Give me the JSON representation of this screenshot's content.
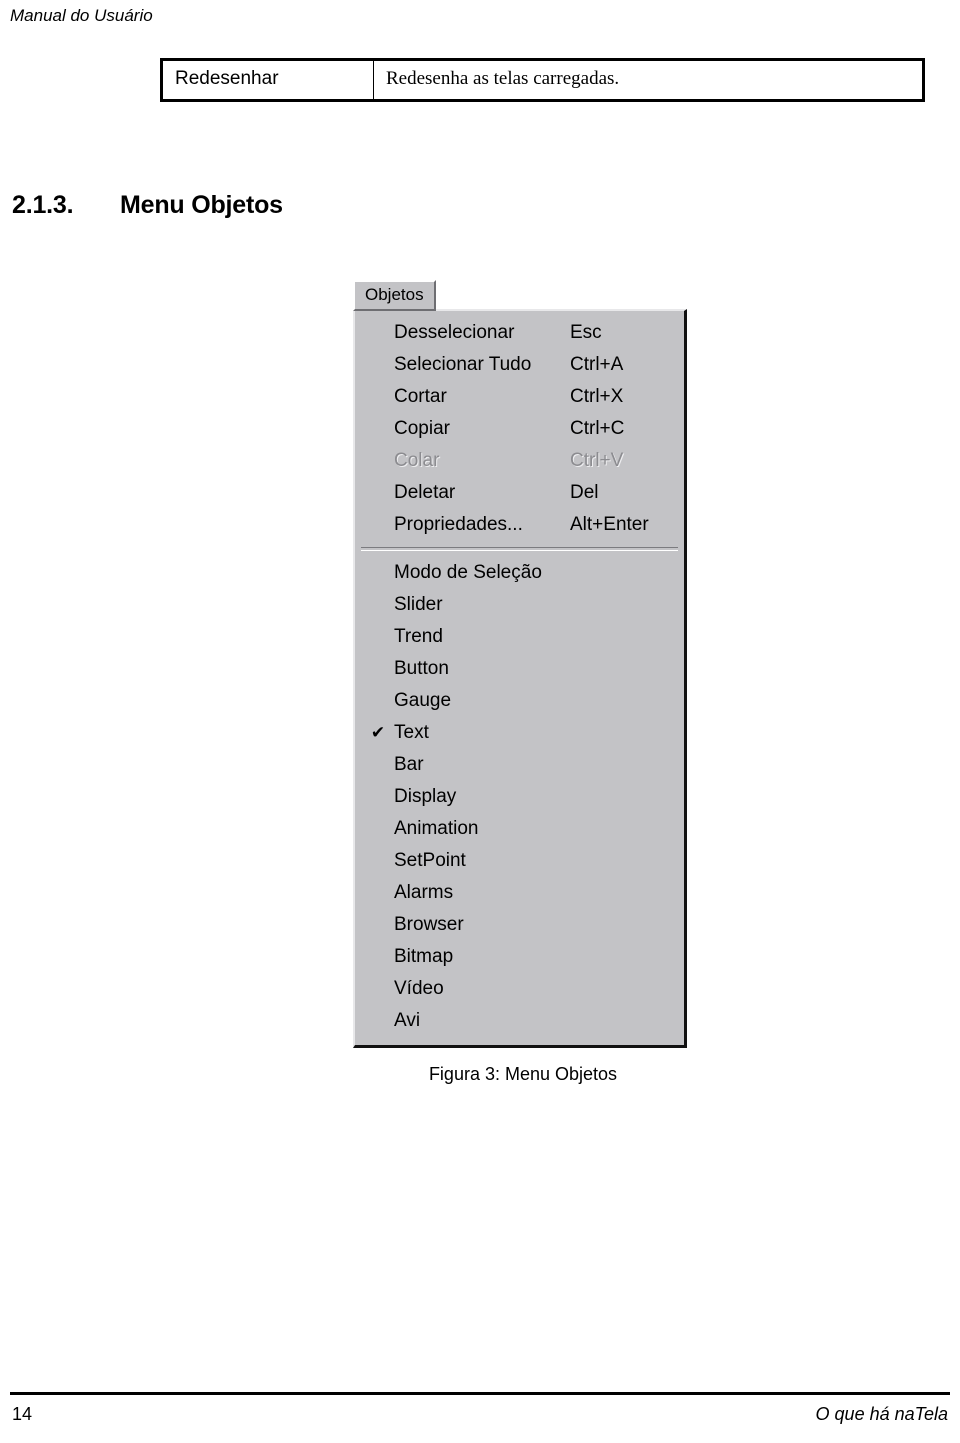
{
  "page": {
    "header_text": "Manual do Usuário",
    "footer_page_number": "14",
    "footer_doc_title": "O que há naTela",
    "background_color": "#ffffff"
  },
  "table": {
    "rows": [
      {
        "term": "Redesenhar",
        "description": "Redesenha as telas carregadas."
      }
    ]
  },
  "heading": {
    "number": "2.1.3.",
    "title": "Menu Objetos"
  },
  "figure": {
    "caption": "Figura 3: Menu Objetos",
    "menubar_button_label": "Objetos",
    "colors": {
      "menu_background": "#c3c3c6",
      "menu_highlight": "#e8e8ea",
      "menu_shadow": "#6e6e72",
      "menu_border": "#111111",
      "disabled_text": "#8c8c90",
      "text": "#000000"
    },
    "groups": [
      {
        "items": [
          {
            "label": "Desselecionar",
            "shortcut": "Esc",
            "checked": false,
            "disabled": false
          },
          {
            "label": "Selecionar Tudo",
            "shortcut": "Ctrl+A",
            "checked": false,
            "disabled": false
          },
          {
            "label": "Cortar",
            "shortcut": "Ctrl+X",
            "checked": false,
            "disabled": false
          },
          {
            "label": "Copiar",
            "shortcut": "Ctrl+C",
            "checked": false,
            "disabled": false
          },
          {
            "label": "Colar",
            "shortcut": "Ctrl+V",
            "checked": false,
            "disabled": true
          },
          {
            "label": "Deletar",
            "shortcut": "Del",
            "checked": false,
            "disabled": false
          },
          {
            "label": "Propriedades...",
            "shortcut": "Alt+Enter",
            "checked": false,
            "disabled": false
          }
        ]
      },
      {
        "items": [
          {
            "label": "Modo de Seleção",
            "shortcut": "",
            "checked": false,
            "disabled": false
          },
          {
            "label": "Slider",
            "shortcut": "",
            "checked": false,
            "disabled": false
          },
          {
            "label": "Trend",
            "shortcut": "",
            "checked": false,
            "disabled": false
          },
          {
            "label": "Button",
            "shortcut": "",
            "checked": false,
            "disabled": false
          },
          {
            "label": "Gauge",
            "shortcut": "",
            "checked": false,
            "disabled": false
          },
          {
            "label": "Text",
            "shortcut": "",
            "checked": true,
            "disabled": false
          },
          {
            "label": "Bar",
            "shortcut": "",
            "checked": false,
            "disabled": false
          },
          {
            "label": "Display",
            "shortcut": "",
            "checked": false,
            "disabled": false
          },
          {
            "label": "Animation",
            "shortcut": "",
            "checked": false,
            "disabled": false
          },
          {
            "label": "SetPoint",
            "shortcut": "",
            "checked": false,
            "disabled": false
          },
          {
            "label": "Alarms",
            "shortcut": "",
            "checked": false,
            "disabled": false
          },
          {
            "label": "Browser",
            "shortcut": "",
            "checked": false,
            "disabled": false
          },
          {
            "label": "Bitmap",
            "shortcut": "",
            "checked": false,
            "disabled": false
          },
          {
            "label": "Vídeo",
            "shortcut": "",
            "checked": false,
            "disabled": false
          },
          {
            "label": "Avi",
            "shortcut": "",
            "checked": false,
            "disabled": false
          }
        ]
      }
    ],
    "check_glyph": "✔"
  }
}
